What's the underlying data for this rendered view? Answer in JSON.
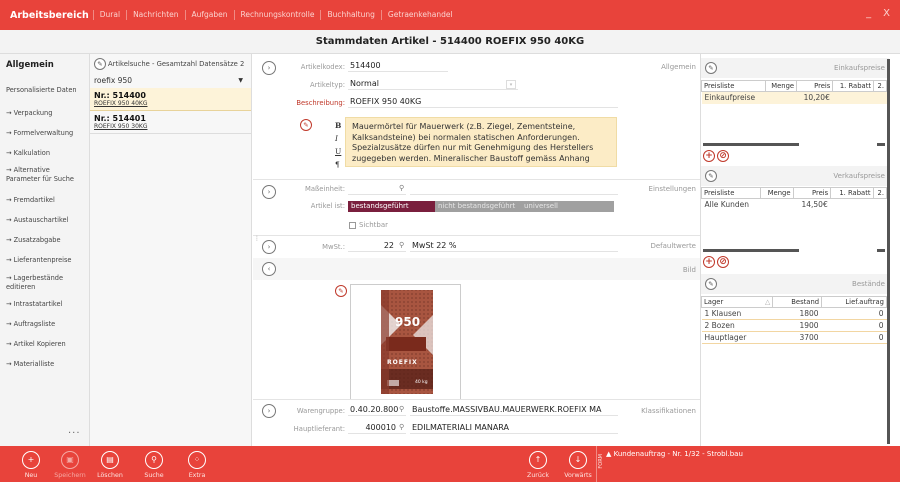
{
  "topbar": {
    "brand": "Arbeitsbereich",
    "tabs": [
      "Dural",
      "Nachrichten",
      "Aufgaben",
      "Rechnungskontrolle",
      "Buchhaltung",
      "Getraenkehandel"
    ],
    "minimize": "_",
    "close": "X"
  },
  "title": "Stammdaten Artikel - 514400 ROEFIX 950 40KG",
  "nav": {
    "heading": "Allgemein",
    "items": [
      "Personalisierte Daten",
      "→ Verpackung",
      "→ Formelverwaltung",
      "→ Kalkulation",
      "→ Alternative Parameter für Suche",
      "→ Fremdartikel",
      "→ Austauschartikel",
      "→ Zusatzabgabe",
      "→ Lieferantenpreise",
      "→ Lagerbestände editieren",
      "→ Intrastatartikel",
      "→ Auftragsliste",
      "→ Artikel Kopieren",
      "→ Materialliste"
    ],
    "more": "..."
  },
  "list": {
    "search_label": "Artikelsuche - Gesamtzahl Datensätze 2",
    "filter_value": "roefix 950",
    "records": [
      {
        "nr": "Nr.: 514400",
        "desc": "ROEFIX 950 40KG",
        "selected": true
      },
      {
        "nr": "Nr.: 514401",
        "desc": "ROEFIX 950 30KG",
        "selected": false
      }
    ]
  },
  "allgemein": {
    "section": "Allgemein",
    "code_label": "Artikelkodex:",
    "code_value": "514400",
    "type_label": "Artikeltyp:",
    "type_value": "Normal",
    "desc_label": "Beschreibung:",
    "desc_value": "ROEFIX 950 40KG",
    "long_text": "Mauermörtel für Mauerwerk (z.B. Ziegel, Zementsteine, Kalksandsteine) bei normalen statischen Anforderungen. Spezialzusätze dürfen nur mit Genehmigung des Herstellers zugegeben werden. Mineralischer Baustoff gemäss Anhang",
    "fmt_b": "B",
    "fmt_i": "I",
    "fmt_u": "U"
  },
  "einstellungen": {
    "section": "Einstellungen",
    "unit_label": "Maßeinheit:",
    "kind_label": "Artikel ist:",
    "kind_options": [
      "bestandsgeführt",
      "nicht bestandsgeführt",
      "universell"
    ],
    "visible_label": "Sichtbar"
  },
  "defaultwerte": {
    "section": "Defaultwerte",
    "vat_label": "MwSt.:",
    "vat_code": "22",
    "vat_text": "MwSt 22 %"
  },
  "bild": {
    "section": "Bild",
    "product_number": "950",
    "brand_text": "ROEFIX",
    "weight": "40 kg"
  },
  "klassifikationen": {
    "section": "Klassifikationen",
    "group_label": "Warengruppe:",
    "group_code": "0.40.20.800",
    "group_text": "Baustoffe.MASSIVBAU.MAUERWERK.ROEFIX MA",
    "supplier_label": "Hauptlieferant:",
    "supplier_code": "400010",
    "supplier_text": "EDILMATERIALI MANARA"
  },
  "einkaufspreise": {
    "title": "Einkaufspreise",
    "columns": [
      "Preisliste",
      "Menge",
      "Preis",
      "1. Rabatt",
      "2."
    ],
    "rows": [
      [
        "Einkaufpreise",
        "",
        "10,20€",
        "",
        ""
      ]
    ]
  },
  "verkaufspreise": {
    "title": "Verkaufspreise",
    "columns": [
      "Preisliste",
      "Menge",
      "Preis",
      "1. Rabatt",
      "2."
    ],
    "rows": [
      [
        "Alle Kunden",
        "",
        "14,50€",
        "",
        ""
      ]
    ]
  },
  "bestaende": {
    "title": "Bestände",
    "columns": [
      "Lager",
      "Bestand",
      "Lief.auftrag"
    ],
    "rows": [
      [
        "1 Klausen",
        "1800",
        "0"
      ],
      [
        "2 Bozen",
        "1900",
        "0"
      ],
      [
        "Hauptlager",
        "3700",
        "0"
      ]
    ]
  },
  "bottom": {
    "buttons": [
      {
        "label": "Neu",
        "glyph": "+"
      },
      {
        "label": "Speichern",
        "glyph": "▣"
      },
      {
        "label": "Löschen",
        "glyph": "▤"
      },
      {
        "label": "Suche",
        "glyph": "⚲"
      },
      {
        "label": "Extra",
        "glyph": "⁘"
      },
      {
        "label": "Zurück",
        "glyph": "↑"
      },
      {
        "label": "Vorwärts",
        "glyph": "↓"
      }
    ],
    "form_label": "FORM",
    "order": "▲ Kundenauftrag - Nr. 1/32 - Strobl.bau"
  },
  "colors": {
    "accent": "#e8433b",
    "highlight": "#fcecc6",
    "selected_toggle": "#7a1f3d",
    "inactive_toggle": "#a0a0a0"
  }
}
